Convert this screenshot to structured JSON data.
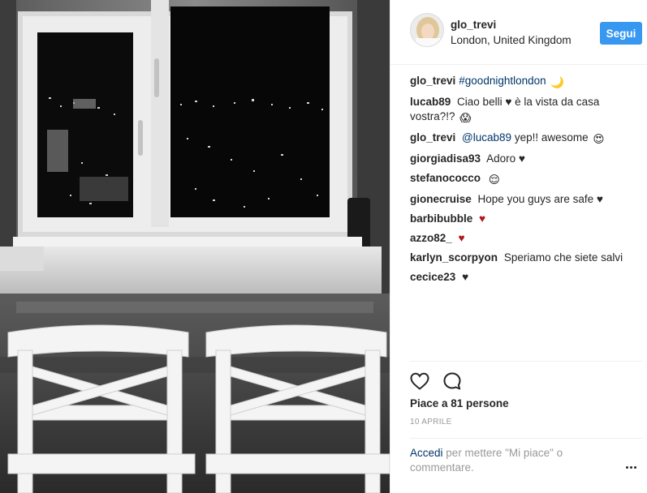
{
  "post": {
    "photo_alt": "",
    "author": {
      "username": "glo_trevi",
      "location": "London, United Kingdom"
    },
    "follow_label": "Segui",
    "caption": {
      "author": "glo_trevi",
      "hashtag": "#goodnightlondon",
      "emoji": "🌙"
    },
    "comments": [
      {
        "author": "lucab89",
        "text": "Ciao belli",
        "heart": "♥",
        "text_after": "è la vista da casa vostra?!?",
        "emoji": "😱"
      },
      {
        "author": "glo_trevi",
        "mention": "@lucab89",
        "text": "yep!! awesome",
        "emoji": "😍"
      },
      {
        "author": "giorgiadisa93",
        "text": "Adoro",
        "heart": "♥"
      },
      {
        "author": "stefanococco",
        "emoji": "😌"
      },
      {
        "author": "gionecruise",
        "text": "Hope you guys are safe",
        "heart": "♥"
      },
      {
        "author": "barbibubble",
        "heart_red": "♥"
      },
      {
        "author": "azzo82_",
        "heart_red": "♥"
      },
      {
        "author": "karlyn_scorpyon",
        "text": "Speriamo che siete salvi"
      },
      {
        "author": "cecice23",
        "heart": "♥"
      }
    ],
    "likes_text": "Piace a 81 persone",
    "date": "10 APRILE",
    "comment_prompt": {
      "login_link": "Accedi",
      "text": "per mettere \"Mi piace\" o commentare."
    },
    "colors": {
      "follow_button": "#3897f0",
      "link": "#003569",
      "red_heart": "#b0161b",
      "text": "#262626",
      "muted": "#999999"
    },
    "icons": {
      "like": "heart-outline-icon",
      "comment": "speech-bubble-icon",
      "more": "more-options-icon"
    }
  }
}
